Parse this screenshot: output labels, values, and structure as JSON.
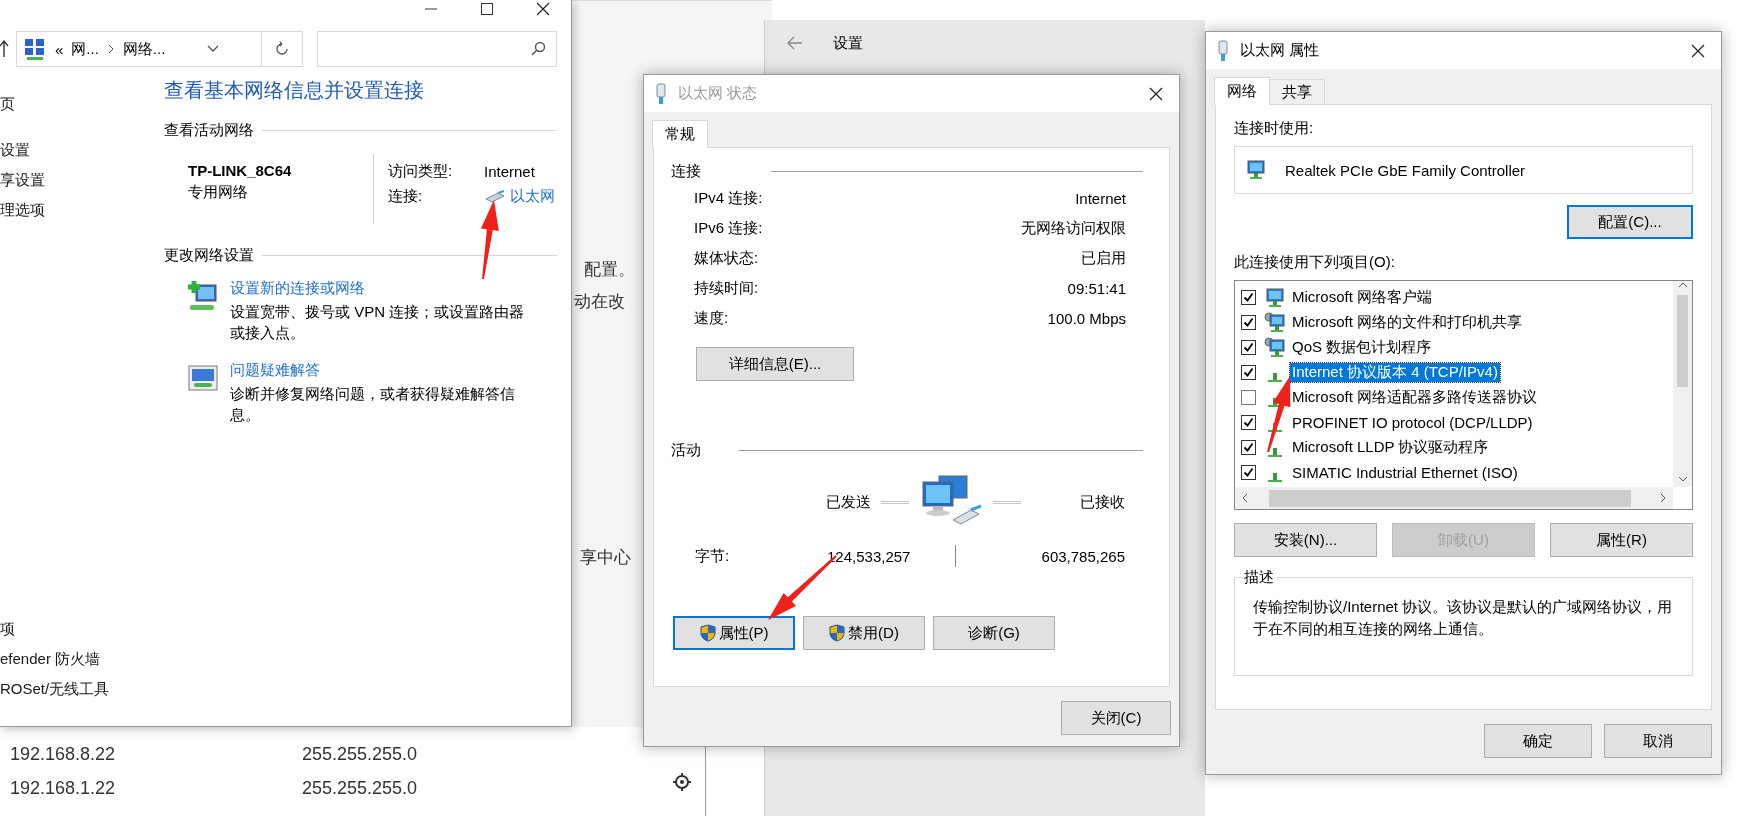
{
  "network_center": {
    "breadcrumb": [
      "«",
      "网...",
      "网络..."
    ],
    "heading": "查看基本网络信息并设置连接",
    "sidebar_top": [
      "页",
      "设置",
      "享设置",
      "理选项"
    ],
    "sidebar_bottom": [
      "项",
      "efender 防火墙",
      "ROSet/无线工具"
    ],
    "active_networks": {
      "title": "查看活动网络",
      "name": "TP-LINK_8C64",
      "category": "专用网络",
      "access_label": "访问类型:",
      "access_value": "Internet",
      "connection_label": "连接:",
      "connection_link": "以太网"
    },
    "change_settings": {
      "title": "更改网络设置",
      "tasks": [
        {
          "kind": "new_connection",
          "link": "设置新的连接或网络",
          "description": "设置宽带、拨号或 VPN 连接；或设置路由器或接入点。"
        },
        {
          "kind": "troubleshoot",
          "link": "问题疑难解答",
          "description": "诊断并修复网络问题，或者获得疑难解答信息。"
        }
      ]
    }
  },
  "settings": {
    "title": "设置",
    "fragments": [
      "配置。",
      "动在改",
      "享中心"
    ]
  },
  "route_table": {
    "rows": [
      {
        "address": "192.168.8.22",
        "mask": "255.255.255.0"
      },
      {
        "address": "192.168.1.22",
        "mask": "255.255.255.0"
      }
    ]
  },
  "status_dialog": {
    "title": "以太网 状态",
    "active": false,
    "tabs": [
      {
        "label": "常规",
        "selected": true
      }
    ],
    "connection_title": "连接",
    "fields": [
      {
        "label": "IPv4 连接:",
        "value": "Internet"
      },
      {
        "label": "IPv6 连接:",
        "value": "无网络访问权限"
      },
      {
        "label": "媒体状态:",
        "value": "已启用"
      },
      {
        "label": "持续时间:",
        "value": "09:51:41"
      },
      {
        "label": "速度:",
        "value": "100.0 Mbps"
      }
    ],
    "details_button": "详细信息(E)...",
    "activity_title": "活动",
    "sent_label": "已发送",
    "received_label": "已接收",
    "bytes_label": "字节:",
    "bytes_sent": "124,533,257",
    "bytes_received": "603,785,265",
    "buttons": [
      {
        "label": "属性(P)",
        "shield": true,
        "focused": true
      },
      {
        "label": "禁用(D)",
        "shield": true,
        "focused": false
      },
      {
        "label": "诊断(G)",
        "shield": false,
        "focused": false
      }
    ],
    "close_button": "关闭(C)"
  },
  "properties_dialog": {
    "title": "以太网 属性",
    "active": true,
    "tabs": [
      {
        "label": "网络",
        "selected": true
      },
      {
        "label": "共享",
        "selected": false
      }
    ],
    "connect_using_label": "连接时使用:",
    "adapter": "Realtek PCIe GbE Family Controller",
    "configure_button": {
      "label": "配置(C)...",
      "focused": true
    },
    "items_label": "此连接使用下列项目(O):",
    "items": [
      {
        "kind": "client",
        "label": "Microsoft 网络客户端",
        "checked": true,
        "selected": false
      },
      {
        "kind": "service",
        "label": "Microsoft 网络的文件和打印机共享",
        "checked": true,
        "selected": false
      },
      {
        "kind": "service",
        "label": "QoS 数据包计划程序",
        "checked": true,
        "selected": false
      },
      {
        "kind": "protocol",
        "label": "Internet 协议版本 4 (TCP/IPv4)",
        "checked": true,
        "selected": true
      },
      {
        "kind": "protocol",
        "label": "Microsoft 网络适配器多路传送器协议",
        "checked": false,
        "selected": false
      },
      {
        "kind": "protocol",
        "label": "PROFINET IO protocol (DCP/LLDP)",
        "checked": true,
        "selected": false
      },
      {
        "kind": "protocol",
        "label": "Microsoft LLDP 协议驱动程序",
        "checked": true,
        "selected": false
      },
      {
        "kind": "protocol",
        "label": "SIMATIC Industrial Ethernet (ISO)",
        "checked": true,
        "selected": false
      }
    ],
    "buttons": [
      {
        "label": "安装(N)...",
        "disabled": false
      },
      {
        "label": "卸载(U)",
        "disabled": true
      },
      {
        "label": "属性(R)",
        "disabled": false
      }
    ],
    "description_title": "描述",
    "description": "传输控制协议/Internet 协议。该协议是默认的广域网络协议，用于在不同的相互连接的网络上通信。",
    "ok_button": "确定",
    "cancel_button": "取消"
  }
}
